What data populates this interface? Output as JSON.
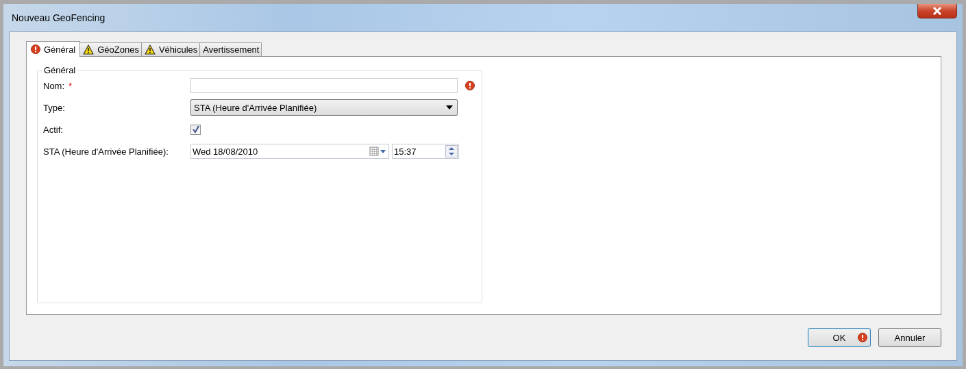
{
  "window": {
    "title": "Nouveau GeoFencing"
  },
  "tabs": [
    {
      "label": "Général",
      "selected": true,
      "kind": "error"
    },
    {
      "label": "GéoZones",
      "selected": false,
      "kind": "warning"
    },
    {
      "label": "Véhicules",
      "selected": false,
      "kind": "warning"
    },
    {
      "label": "Avertissement",
      "selected": false,
      "kind": "plain"
    }
  ],
  "group": {
    "title": "Général",
    "fields": [
      {
        "kind": "text",
        "label": "Nom:",
        "required": "*",
        "error": true
      },
      {
        "kind": "select",
        "label": "Type:",
        "value": "STA (Heure d'Arrivée Planifiée)"
      },
      {
        "kind": "checkbox",
        "label": "Actif:",
        "checked": true
      },
      {
        "kind": "datetime",
        "label": "STA (Heure d'Arrivée Planifiée):",
        "date": "Wed 18/08/2010",
        "time": "15:37"
      }
    ]
  },
  "buttons": [
    {
      "label": "OK",
      "default": true,
      "error": true
    },
    {
      "label": "Annuler",
      "default": false,
      "error": false
    }
  ]
}
